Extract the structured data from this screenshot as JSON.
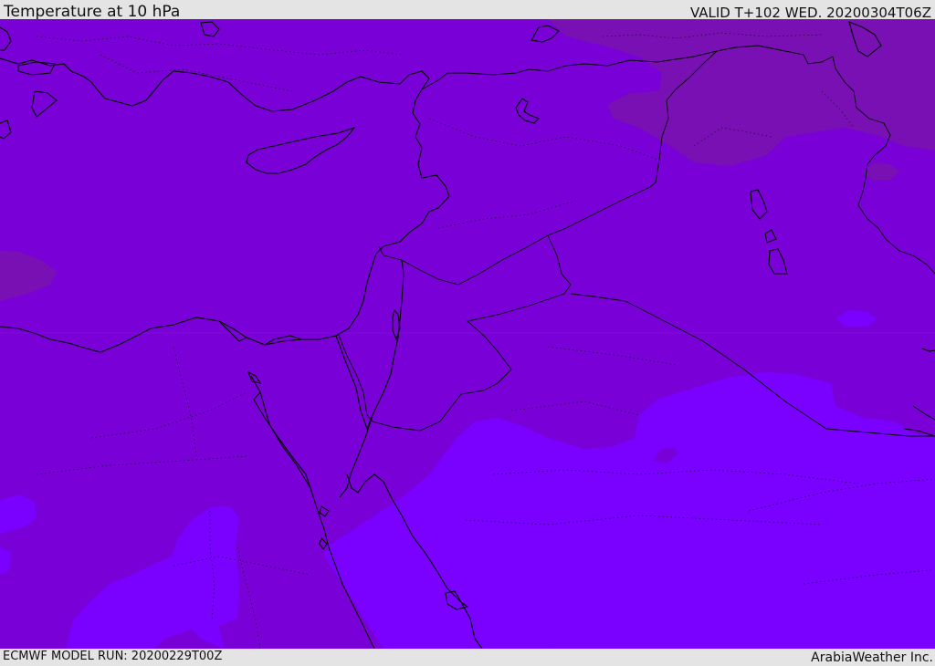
{
  "header": {
    "title": "Temperature at 10 hPa",
    "valid": "VALID T+102 WED. 20200304T06Z"
  },
  "footer": {
    "model_run": "ECMWF MODEL RUN: 20200229T00Z",
    "credit": "ArabiaWeather Inc."
  },
  "map": {
    "field": "temperature",
    "level": "10 hPa",
    "colors": {
      "base": "#7900d6",
      "warm_band": "#7a00ff",
      "cold_band": "#7910b4",
      "borders": "#000000"
    }
  }
}
